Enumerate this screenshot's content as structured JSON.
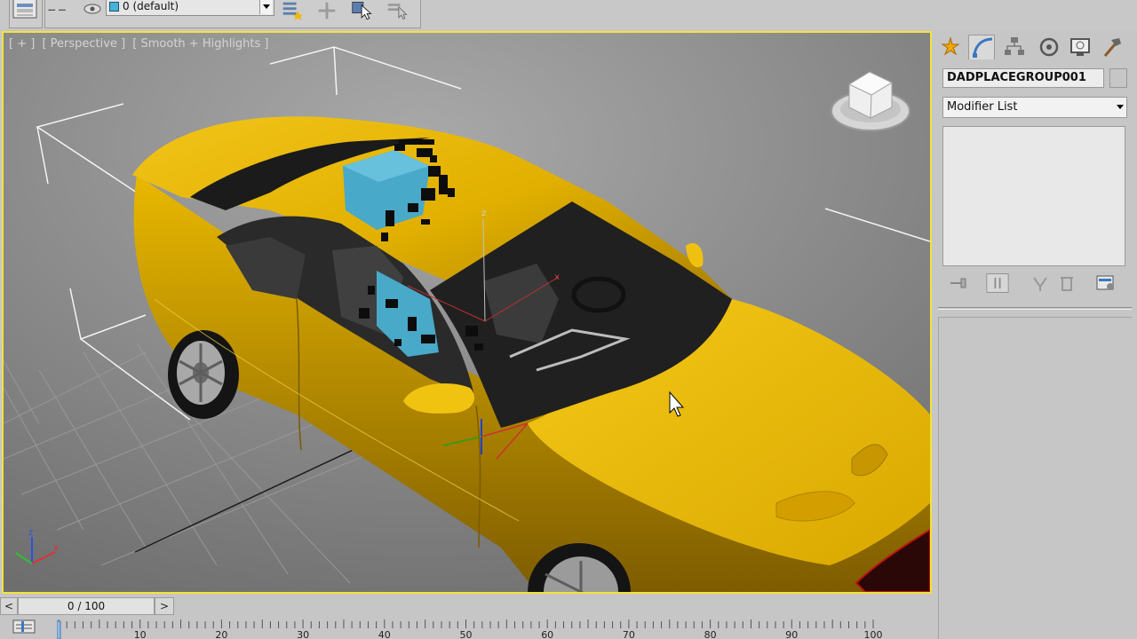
{
  "toolbar": {
    "layer_dropdown": {
      "value": "0 (default)",
      "swatch_color": "#48b1d6"
    },
    "icons": [
      "layer-manager-icon",
      "freeze-icon",
      "hide-icon",
      "create-layer-icon",
      "add-to-layer-icon",
      "select-in-layer-icon",
      "layer-properties-icon"
    ]
  },
  "viewport": {
    "label": {
      "plus": "[ + ]",
      "view": "[ Perspective ]",
      "shading": "[ Smooth + Highlights ]"
    },
    "active_border_color": "#f3e23c",
    "car_color": "#e2b200",
    "selection_color": "#48a9c8",
    "axis_labels": {
      "z": "z",
      "x": "x"
    }
  },
  "command_panel": {
    "tabs": [
      "create-tab",
      "modify-tab",
      "hierarchy-tab",
      "motion-tab",
      "display-tab",
      "utilities-tab"
    ],
    "active_tab": "modify-tab",
    "object_name": "DADPLACEGROUP001",
    "modifier_list": "Modifier List",
    "stack_buttons": [
      "pin-stack-icon",
      "show-end-result-icon",
      "make-unique-icon",
      "remove-modifier-icon",
      "configure-modifier-sets-icon"
    ]
  },
  "timeline": {
    "prev_label": "<",
    "slider_label": "0 / 100",
    "next_label": ">",
    "ruler_labels": [
      "0",
      "10",
      "20",
      "30",
      "40",
      "50",
      "60",
      "70",
      "80",
      "90",
      "100"
    ]
  }
}
